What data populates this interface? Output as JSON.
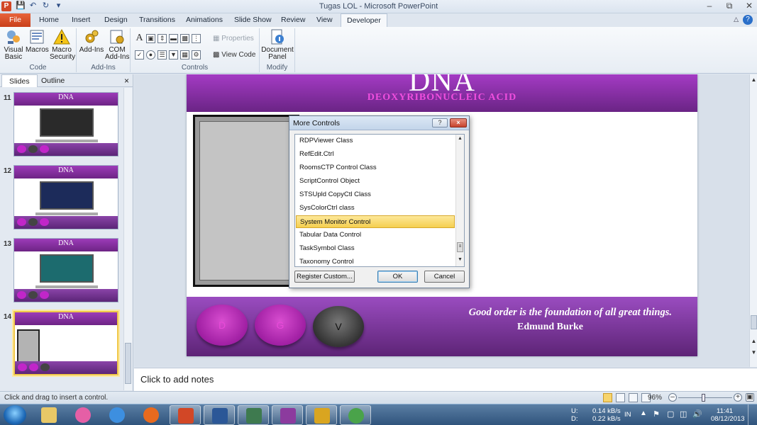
{
  "window": {
    "title": "Tugas LOL  -  Microsoft PowerPoint",
    "app_badge": "P",
    "qat_icons": [
      "save-icon",
      "undo-icon",
      "redo-icon",
      "customize-qat-icon"
    ],
    "window_controls": [
      "minimize-icon",
      "restore-icon",
      "close-icon"
    ]
  },
  "tabs": [
    {
      "label": "File"
    },
    {
      "label": "Home"
    },
    {
      "label": "Insert"
    },
    {
      "label": "Design"
    },
    {
      "label": "Transitions"
    },
    {
      "label": "Animations"
    },
    {
      "label": "Slide Show"
    },
    {
      "label": "Review"
    },
    {
      "label": "View"
    },
    {
      "label": "Developer"
    }
  ],
  "ribbon": {
    "code": {
      "label": "Code",
      "visual_basic": "Visual\nBasic",
      "macros": "Macros",
      "macro_security": "Macro\nSecurity"
    },
    "addins": {
      "label": "Add-Ins",
      "add_ins": "Add-Ins",
      "com_add_ins": "COM\nAdd-Ins"
    },
    "controls": {
      "label": "Controls",
      "properties": "Properties",
      "view_code": "View Code",
      "row1_icons": [
        "label-control-icon",
        "image-control-icon",
        "spin-button-icon",
        "scrollbar-icon",
        "picture-icon",
        "more-controls-icon"
      ],
      "row2_icons": [
        "checkbox-icon",
        "option-button-icon",
        "listbox-icon",
        "combobox-icon",
        "toggle-button-icon",
        "tools-icon"
      ]
    },
    "modify": {
      "label": "Modify",
      "document_panel": "Document\nPanel"
    }
  },
  "left_pane": {
    "tabs": [
      "Slides",
      "Outline"
    ],
    "close": "×",
    "thumbnails": [
      {
        "number": "11",
        "title": "DNA",
        "pic_color": "#2a2a2a"
      },
      {
        "number": "12",
        "title": "DNA",
        "pic_color": "#1c2b5a"
      },
      {
        "number": "13",
        "title": "DNA",
        "pic_color": "#1c6b6e"
      },
      {
        "number": "14",
        "title": "DNA",
        "pic_color": "#b3b3b3",
        "selected": true
      }
    ]
  },
  "slide": {
    "title": "DNA",
    "subtitle": "DEOXYRIBONUCLEIC  ACID",
    "buttons": [
      "D",
      "G",
      "V"
    ],
    "quote": "Good order is the foundation of all great things.",
    "author": "Edmund  Burke",
    "colors": {
      "header": "#8e33ae",
      "subtitle": "#ef4ede",
      "footer": "#7a3a9c"
    }
  },
  "dialog": {
    "title": "More Controls",
    "help": "?",
    "close": "×",
    "items": [
      "RDPViewer Class",
      "RefEdit.Ctrl",
      "RoomsCTP Control Class",
      "ScriptControl Object",
      "STSUpld CopyCtl Class",
      "SysColorCtrl class",
      "System Monitor Control",
      "Tabular Data Control",
      "TaskSymbol Class",
      "Taxonomy Control"
    ],
    "selected_item": "System Monitor Control",
    "register_button": "Register Custom...",
    "ok_button": "OK",
    "cancel_button": "Cancel"
  },
  "notes": {
    "placeholder": "Click to add notes"
  },
  "status": {
    "message": "Click and drag to insert a control.",
    "zoom": "96%"
  },
  "taskbar": {
    "apps": [
      {
        "name": "explorer",
        "color": "#e8c867"
      },
      {
        "name": "osu",
        "color": "#e55fa6"
      },
      {
        "name": "internet-explorer",
        "color": "#3d8fe0"
      },
      {
        "name": "firefox",
        "color": "#e86a1e"
      },
      {
        "name": "powerpoint",
        "color": "#d24726"
      },
      {
        "name": "word",
        "color": "#2b5797"
      },
      {
        "name": "presentation-viewer",
        "color": "#3e7a4f"
      },
      {
        "name": "paint-tool",
        "color": "#8c3b9e"
      },
      {
        "name": "sticky-tool",
        "color": "#d9a520"
      },
      {
        "name": "globe-app",
        "color": "#4aa34a"
      }
    ],
    "net_up_label": "U:",
    "net_down_label": "D:",
    "net_up": "0.14 kB/s",
    "net_down": "0.22 kB/s",
    "lang": "IN",
    "time": "11:41",
    "date": "08/12/2013"
  }
}
